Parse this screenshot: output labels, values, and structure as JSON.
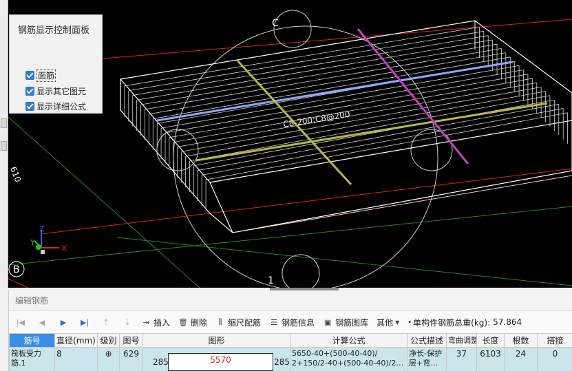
{
  "viewport": {
    "panel": {
      "title": "钢筋显示控制面板",
      "checkboxes": [
        {
          "label": "面筋",
          "checked": true
        },
        {
          "label": "显示其它图元",
          "checked": true
        },
        {
          "label": "显示详细公式",
          "checked": true
        }
      ]
    },
    "rebar_annotation": "C8-200;C8@200",
    "axis_labels": {
      "top": "C",
      "bottom": "1",
      "left_bottom": "B",
      "left_side": "610"
    },
    "gizmo": {
      "x": "X",
      "y": "Y",
      "z": "Z"
    }
  },
  "editor": {
    "section_title": "编辑钢筋",
    "toolbar": {
      "insert": "插入",
      "delete": "删除",
      "scale": "缩尺配筋",
      "info": "钢筋信息",
      "library": "钢筋图库",
      "other": "其他",
      "total_label": "单构件钢筋总重(kg):",
      "total_value": "57.864"
    },
    "columns": [
      "筋号",
      "直径(mm)",
      "级别",
      "图号",
      "图形",
      "计算公式",
      "公式描述",
      "弯曲调整",
      "长度",
      "根数",
      "搭接"
    ],
    "rows": [
      {
        "name": "筏板受力筋.1",
        "diameter": "8",
        "grade": "⊕",
        "figure_no": "629",
        "shape_left": "285",
        "shape_mid": "5570",
        "shape_right": "285",
        "formula_line1": "5650-40+(500-40-40)/",
        "formula_line2": "2+150/2-40+(500-40-40)/2…",
        "desc_line1": "净长-保护",
        "desc_line2": "层+弯…",
        "bend": "37",
        "length": "6103",
        "count": "24",
        "lap": "0"
      }
    ]
  },
  "colors": {
    "slab_lines": "#ffffff",
    "rebar_blue": "#8fa6ff",
    "rebar_yellow": "#b7b84a",
    "rebar_magenta": "#c040c0",
    "axis_red": "#e02020",
    "axis_green": "#1f8a1f",
    "header_blue": "#3a8ee6",
    "row_bg": "#cbe6ea"
  }
}
